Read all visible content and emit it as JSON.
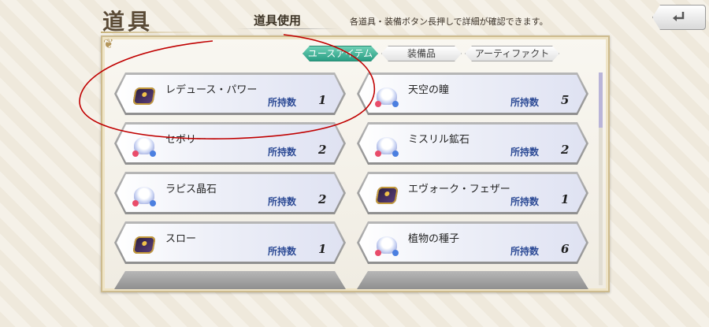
{
  "header": {
    "title": "道具",
    "subtitle": "道具使用",
    "hint": "各道具・装備ボタン長押しで詳細が確認できます。",
    "back_icon": "return-arrow-icon"
  },
  "tabs": [
    {
      "label": "ユースアイテム",
      "active": true
    },
    {
      "label": "装備品",
      "active": false
    },
    {
      "label": "アーティファクト",
      "active": false
    }
  ],
  "qty_label": "所持数",
  "items": [
    {
      "name": "レデュース・パワー",
      "qty": "1",
      "icon": "book-icon"
    },
    {
      "name": "天空の瞳",
      "qty": "5",
      "icon": "orb-icon"
    },
    {
      "name": "セボリー",
      "qty": "2",
      "icon": "orb-icon"
    },
    {
      "name": "ミスリル鉱石",
      "qty": "2",
      "icon": "orb-icon"
    },
    {
      "name": "ラピス晶石",
      "qty": "2",
      "icon": "orb-icon"
    },
    {
      "name": "エヴォーク・フェザー",
      "qty": "1",
      "icon": "book-icon"
    },
    {
      "name": "スロー",
      "qty": "1",
      "icon": "book-icon"
    },
    {
      "name": "植物の種子",
      "qty": "6",
      "icon": "orb-icon"
    }
  ],
  "colors": {
    "active_tab": "#2a9e84",
    "qty_label": "#2c4a95",
    "annotation": "#c00000"
  }
}
